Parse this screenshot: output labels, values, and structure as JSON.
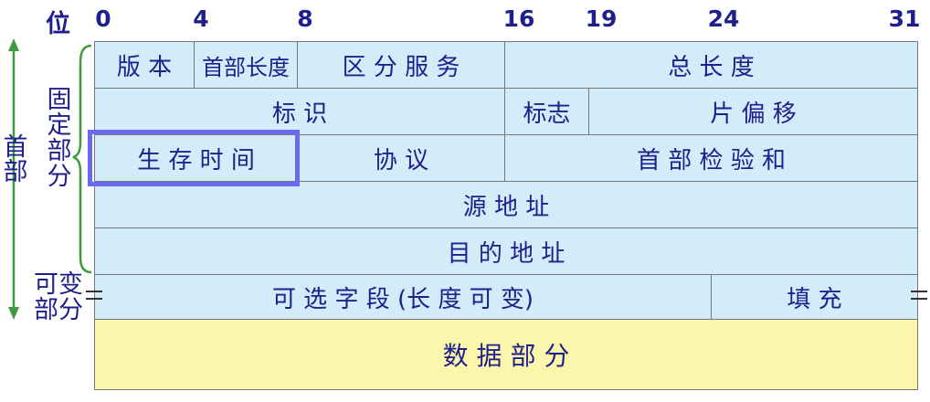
{
  "ruler": {
    "title": "位",
    "bits": [
      "0",
      "4",
      "8",
      "16",
      "19",
      "24",
      "31"
    ]
  },
  "side": {
    "header": "首部",
    "fixed": "固定部分",
    "variable": "可变部分"
  },
  "rows": {
    "r1": {
      "version": "版 本",
      "ihl": "首部长度",
      "tos": "区 分 服 务",
      "total_length": "总  长  度"
    },
    "r2": {
      "identification": "标    识",
      "flags": "标志",
      "fragment_offset": "片  偏  移"
    },
    "r3": {
      "ttl": "生 存 时 间",
      "protocol": "协    议",
      "checksum": "首  部  检  验  和"
    },
    "r4": {
      "src": "源  地  址"
    },
    "r5": {
      "dst": "目  的  地  址"
    },
    "r6": {
      "options": "可  选  字  段  (长  度  可  变)",
      "padding": "填    充"
    },
    "data": {
      "label": "数     据     部     分"
    }
  },
  "colors": {
    "header_fill": "#d2ecfa",
    "data_fill": "#fcf6ad",
    "text": "#1f1f8c",
    "highlight": "#6a6af0",
    "bracket": "#3f9b3f"
  }
}
